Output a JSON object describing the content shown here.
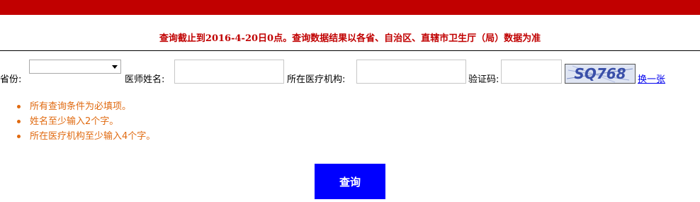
{
  "header": {
    "notice": "查询截止到2016-4-20日0点。查询数据结果以各省、自治区、直辖市卫生厅（局）数据为准"
  },
  "form": {
    "province_label": "省份:",
    "province_value": "",
    "doctor_name_label": "医师姓名:",
    "doctor_name_value": "",
    "institution_label": "所在医疗机构:",
    "institution_value": "",
    "captcha_label": "验证码:",
    "captcha_value": "",
    "captcha_text": "SQ768",
    "refresh_captcha_label": "换一张"
  },
  "tips": [
    "所有查询条件为必填项。",
    "姓名至少输入2个字。",
    "所在医疗机构至少输入4个字。"
  ],
  "submit_label": "查询",
  "colors": {
    "top_bar": "#c10000",
    "notice": "#c00000",
    "tips": "#e06a10",
    "submit_bg": "#0000ff"
  },
  "icons": {
    "dropdown": "chevron-down-icon",
    "bullet": "bullet-dot-icon",
    "captcha": "captcha-image"
  }
}
